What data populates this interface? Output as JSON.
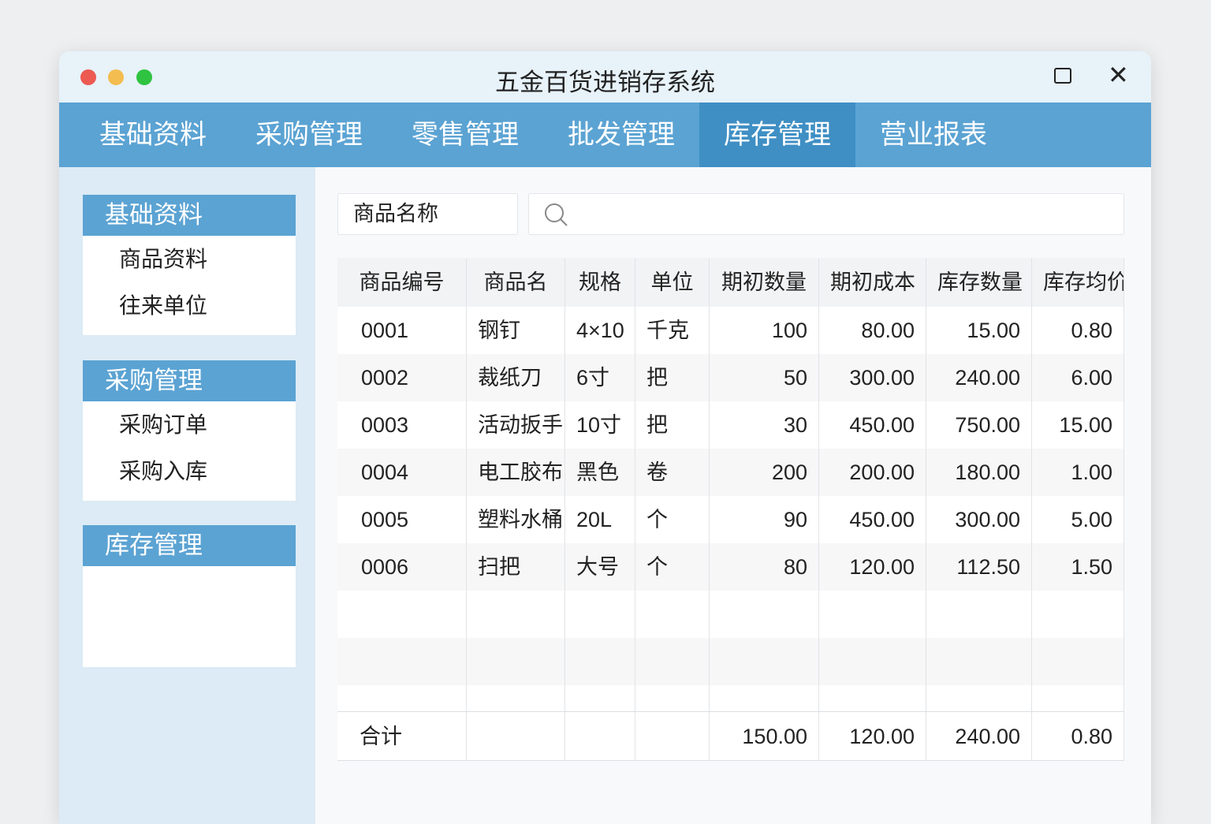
{
  "window": {
    "title": "五金百货进销存系统",
    "colors": {
      "close": "#ec5a52",
      "minimize": "#f4bd50",
      "zoom": "#2fc341",
      "accent": "#5ba3d3",
      "active": "#3f8fc4"
    }
  },
  "menu": [
    {
      "label": "基础资料"
    },
    {
      "label": "采购管理"
    },
    {
      "label": "零售管理"
    },
    {
      "label": "批发管理"
    },
    {
      "label": "库存管理",
      "active": true
    },
    {
      "label": "营业报表"
    }
  ],
  "sidebar": [
    {
      "title": "基础资料",
      "items": [
        "商品资料",
        "往来单位"
      ]
    },
    {
      "title": "采购管理",
      "items": [
        "采购订单",
        "采购入库"
      ]
    },
    {
      "title": "库存管理",
      "items": []
    }
  ],
  "search": {
    "label": "商品名称",
    "value": "",
    "icon": "search-icon"
  },
  "table": {
    "columns": [
      "商品编号",
      "商品名",
      "规格",
      "单位",
      "期初数量",
      "期初成本",
      "库存数量",
      "库存均价"
    ],
    "rows": [
      [
        "0001",
        "钢钉",
        "4×10",
        "千克",
        "100",
        "80.00",
        "15.00",
        "0.80"
      ],
      [
        "0002",
        "裁纸刀",
        "6寸",
        "把",
        "50",
        "300.00",
        "240.00",
        "6.00"
      ],
      [
        "0003",
        "活动扳手",
        "10寸",
        "把",
        "30",
        "450.00",
        "750.00",
        "15.00"
      ],
      [
        "0004",
        "电工胶布",
        "黑色",
        "卷",
        "200",
        "200.00",
        "180.00",
        "1.00"
      ],
      [
        "0005",
        "塑料水桶",
        "20L",
        "个",
        "90",
        "450.00",
        "300.00",
        "5.00"
      ],
      [
        "0006",
        "扫把",
        "大号",
        "个",
        "80",
        "120.00",
        "112.50",
        "1.50"
      ]
    ],
    "total": [
      "合计",
      "",
      "",
      "",
      "150.00",
      "120.00",
      "240.00",
      "0.80"
    ]
  }
}
